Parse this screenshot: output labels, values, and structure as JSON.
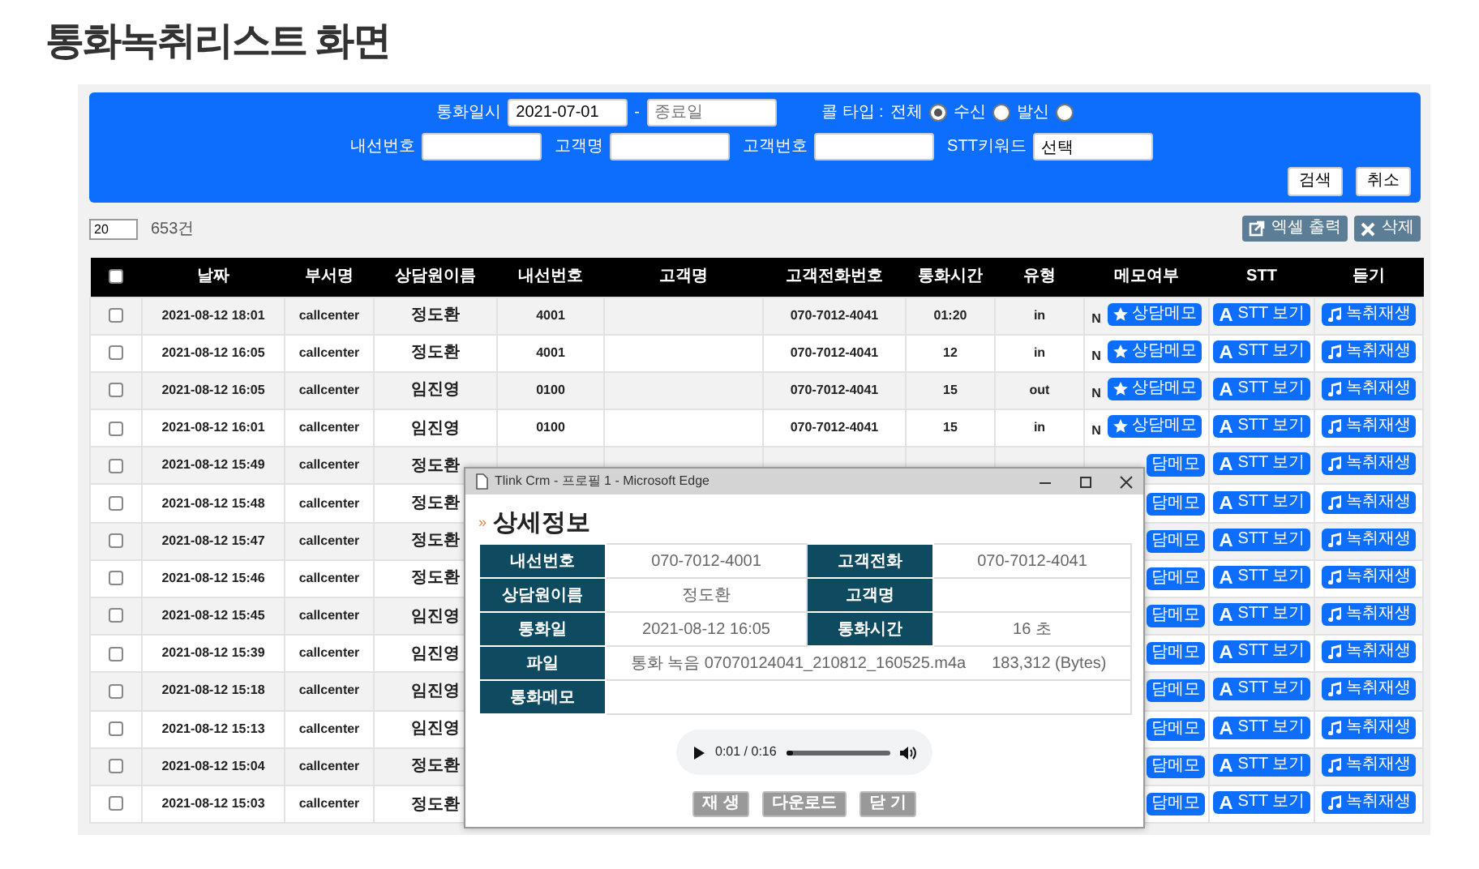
{
  "page_title": "통화녹취리스트 화면",
  "search": {
    "date_label": "통화일시",
    "start_date": "2021-07-01",
    "dash": "-",
    "end_date_placeholder": "종료일",
    "call_type_label": "콜 타입 :",
    "radios": [
      {
        "label": "전체",
        "selected": true
      },
      {
        "label": "수신",
        "selected": false
      },
      {
        "label": "발신",
        "selected": false
      }
    ],
    "fields": [
      {
        "label": "내선번호"
      },
      {
        "label": "고객명"
      },
      {
        "label": "고객번호"
      },
      {
        "label": "STT키워드",
        "value": "선택"
      }
    ],
    "buttons": [
      "검색",
      "취소"
    ]
  },
  "page_size": "20",
  "total": "653건",
  "actions": [
    {
      "kind": "excel",
      "label": "엑셀 출력"
    },
    {
      "kind": "delete",
      "label": "삭제"
    }
  ],
  "table": {
    "header_checked": false,
    "columns": [
      "날짜",
      "부서명",
      "상담원이름",
      "내선번호",
      "고객명",
      "고객전화번호",
      "통화시간",
      "유형",
      "메모여부",
      "STT",
      "듣기"
    ],
    "rows": [
      {
        "covered": false,
        "checked": false,
        "date": "2021-08-12 18:01",
        "dept": "callcenter",
        "agent": "정도환",
        "ext": "4001",
        "phone": "070-7012-4041",
        "duration": "01:20",
        "type": "in",
        "memo_flag": "N",
        "memo_button": "상담메모",
        "stt_button": "STT 보기",
        "listen_button": "녹취재생"
      },
      {
        "covered": false,
        "checked": false,
        "date": "2021-08-12 16:05",
        "dept": "callcenter",
        "agent": "정도환",
        "ext": "4001",
        "phone": "070-7012-4041",
        "duration": "12",
        "type": "in",
        "memo_flag": "N",
        "memo_button": "상담메모",
        "stt_button": "STT 보기",
        "listen_button": "녹취재생"
      },
      {
        "covered": false,
        "checked": false,
        "date": "2021-08-12 16:05",
        "dept": "callcenter",
        "agent": "임진영",
        "ext": "0100",
        "phone": "070-7012-4041",
        "duration": "15",
        "type": "out",
        "memo_flag": "N",
        "memo_button": "상담메모",
        "stt_button": "STT 보기",
        "listen_button": "녹취재생"
      },
      {
        "covered": false,
        "checked": false,
        "date": "2021-08-12 16:01",
        "dept": "callcenter",
        "agent": "임진영",
        "ext": "0100",
        "phone": "070-7012-4041",
        "duration": "15",
        "type": "in",
        "memo_flag": "N",
        "memo_button": "상담메모",
        "stt_button": "STT 보기",
        "listen_button": "녹취재생"
      },
      {
        "covered": true,
        "checked": false,
        "date": "2021-08-12 15:49",
        "dept": "callcenter",
        "agent": "정도환",
        "memo_button": "담메모",
        "stt_button": "STT 보기",
        "listen_button": "녹취재생"
      },
      {
        "covered": true,
        "checked": false,
        "date": "2021-08-12 15:48",
        "dept": "callcenter",
        "agent": "정도환",
        "memo_button": "담메모",
        "stt_button": "STT 보기",
        "listen_button": "녹취재생"
      },
      {
        "covered": true,
        "checked": false,
        "date": "2021-08-12 15:47",
        "dept": "callcenter",
        "agent": "정도환",
        "memo_button": "담메모",
        "stt_button": "STT 보기",
        "listen_button": "녹취재생"
      },
      {
        "covered": true,
        "checked": false,
        "date": "2021-08-12 15:46",
        "dept": "callcenter",
        "agent": "정도환",
        "memo_button": "담메모",
        "stt_button": "STT 보기",
        "listen_button": "녹취재생"
      },
      {
        "covered": true,
        "checked": false,
        "date": "2021-08-12 15:45",
        "dept": "callcenter",
        "agent": "임진영",
        "memo_button": "담메모",
        "stt_button": "STT 보기",
        "listen_button": "녹취재생"
      },
      {
        "covered": true,
        "checked": false,
        "date": "2021-08-12 15:39",
        "dept": "callcenter",
        "agent": "임진영",
        "memo_button": "담메모",
        "stt_button": "STT 보기",
        "listen_button": "녹취재생"
      },
      {
        "covered": true,
        "checked": false,
        "date": "2021-08-12 15:18",
        "dept": "callcenter",
        "agent": "임진영",
        "memo_button": "담메모",
        "stt_button": "STT 보기",
        "listen_button": "녹취재생"
      },
      {
        "covered": true,
        "checked": false,
        "date": "2021-08-12 15:13",
        "dept": "callcenter",
        "agent": "임진영",
        "memo_button": "담메모",
        "stt_button": "STT 보기",
        "listen_button": "녹취재생"
      },
      {
        "covered": true,
        "checked": false,
        "date": "2021-08-12 15:04",
        "dept": "callcenter",
        "agent": "정도환",
        "memo_button": "담메모",
        "stt_button": "STT 보기",
        "listen_button": "녹취재생"
      },
      {
        "covered": true,
        "checked": false,
        "date": "2021-08-12 15:03",
        "dept": "callcenter",
        "agent": "정도환",
        "memo_button": "담메모",
        "stt_button": "STT 보기",
        "listen_button": "녹취재생"
      }
    ]
  },
  "popup": {
    "window_title": "Tlink Crm - 프로필 1 - Microsoft Edge",
    "heading_mark": "»",
    "heading": "상세정보",
    "details": [
      [
        {
          "label": "내선번호",
          "value": "070-7012-4001"
        },
        {
          "label": "고객전화",
          "value": "070-7012-4041"
        }
      ],
      [
        {
          "label": "상담원이름",
          "value": "정도환"
        },
        {
          "label": "고객명"
        }
      ],
      [
        {
          "label": "통화일",
          "value": "2021-08-12 16:05"
        },
        {
          "label": "통화시간",
          "value": "16 초"
        }
      ],
      [
        {
          "label": "파일",
          "value": "통화 녹음 07070124041_210812_160525.m4a",
          "extra": "183,312 (Bytes)"
        }
      ],
      [
        {
          "label": "통화메모"
        }
      ]
    ],
    "player": {
      "time": "0:01 / 0:16",
      "level": 0.06
    },
    "buttons": [
      "재 생",
      "다운로드",
      "닫 기"
    ]
  }
}
